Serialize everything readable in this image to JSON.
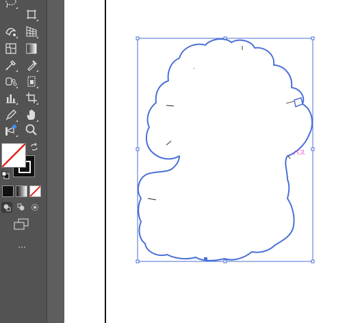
{
  "toolbar": {
    "tools": [
      {
        "name": "lasso-tool-icon"
      },
      {
        "name": "artboard-tool-icon"
      },
      {
        "name": "warp-tool-icon"
      },
      {
        "name": "perspective-grid-tool-icon"
      },
      {
        "name": "mesh-tool-icon"
      },
      {
        "name": "gradient-tool-icon"
      },
      {
        "name": "eyedropper-tool-icon"
      },
      {
        "name": "color-picker-tool-icon"
      },
      {
        "name": "symbol-sprayer-tool-icon"
      },
      {
        "name": "print-tiling-tool-icon"
      },
      {
        "name": "column-graph-tool-icon"
      },
      {
        "name": "slice-tool-icon"
      },
      {
        "name": "pen-tool-icon"
      },
      {
        "name": "hand-tool-icon"
      },
      {
        "name": "puppet-warp-tool-icon"
      },
      {
        "name": "zoom-tool-icon"
      }
    ],
    "fill_color": "#ffffff",
    "stroke_color": "#111111",
    "more_label": "..."
  },
  "canvas": {
    "anchor_hint": "パス",
    "selection_color": "#4a6fd6",
    "path_color": "#4a6fd6"
  }
}
